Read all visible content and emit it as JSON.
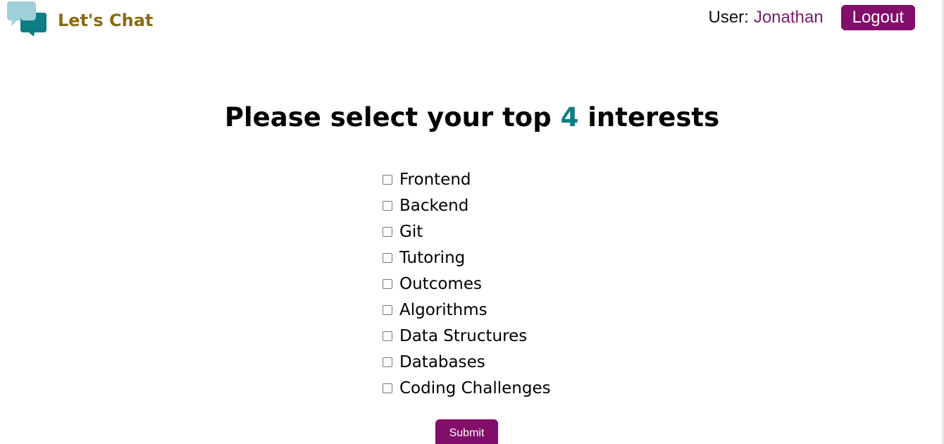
{
  "header": {
    "brand_name": "Let's Chat",
    "logo_icon": "chat-bubbles-icon",
    "user_label": "User:",
    "user_name": "Jonathan",
    "logout_label": "Logout"
  },
  "main": {
    "heading_prefix": "Please select your top",
    "heading_count": "4",
    "heading_suffix": "interests",
    "interests": [
      {
        "label": "Frontend",
        "checked": false
      },
      {
        "label": "Backend",
        "checked": false
      },
      {
        "label": "Git",
        "checked": false
      },
      {
        "label": "Tutoring",
        "checked": false
      },
      {
        "label": "Outcomes",
        "checked": false
      },
      {
        "label": "Algorithms",
        "checked": false
      },
      {
        "label": "Data Structures",
        "checked": false
      },
      {
        "label": "Databases",
        "checked": false
      },
      {
        "label": "Coding Challenges",
        "checked": false
      }
    ],
    "submit_label": "Submit"
  },
  "colors": {
    "brand_text": "#8a6b12",
    "accent_purple": "#820d6a",
    "user_name": "#7a1c6b",
    "count_teal": "#0f7c87",
    "logo_light_bubble": "#9fcfd8",
    "logo_dark_bubble": "#0d7d86"
  }
}
